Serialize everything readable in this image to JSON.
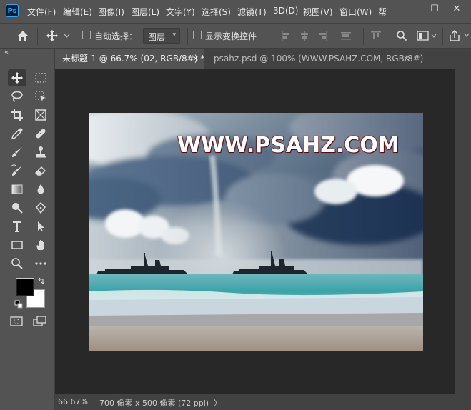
{
  "app": {
    "logo": "Ps"
  },
  "menu": [
    "文件(F)",
    "编辑(E)",
    "图像(I)",
    "图层(L)",
    "文字(Y)",
    "选择(S)",
    "滤镜(T)",
    "3D(D)",
    "视图(V)",
    "窗口(W)",
    "帮"
  ],
  "window_controls": {
    "minimize": "—",
    "maximize": "☐",
    "close": "✕"
  },
  "options": {
    "auto_select_label": "自动选择：",
    "auto_select_value": "图层",
    "show_transform_label": "显示变换控件"
  },
  "tabs": [
    {
      "label": "未标题-1 @ 66.7% (02, RGB/8#) *",
      "close": "×"
    },
    {
      "label": "psahz.psd @ 100% (WWW.PSAHZ.COM, RGB/8#)",
      "close": "×"
    }
  ],
  "toolbox": {
    "collapse": "«"
  },
  "canvas": {
    "watermark": "WWW.PSAHZ.COM"
  },
  "status": {
    "zoom": "66.67%",
    "doc_info": "700 像素 x 500 像素 (72 ppi)",
    "arrow": "〉"
  },
  "colors": {
    "foreground": "#000000",
    "background": "#ffffff",
    "accent": "#31a8ff"
  }
}
